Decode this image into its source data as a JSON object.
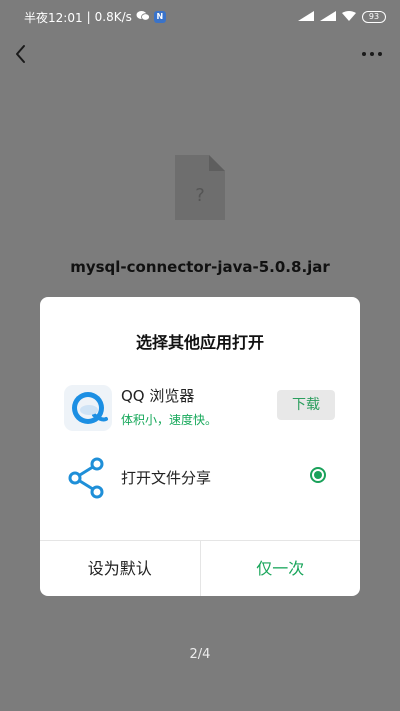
{
  "status_bar": {
    "time": "半夜12:01",
    "speed": "0.8K/s",
    "notification_badge": "N",
    "battery": "93"
  },
  "file": {
    "icon_glyph": "?",
    "name": "mysql-connector-java-5.0.8.jar"
  },
  "dialog": {
    "title": "选择其他应用打开",
    "apps": [
      {
        "name": "QQ 浏览器",
        "subtitle": "体积小，速度快。",
        "action": "下载",
        "icon": "qq-browser-icon"
      },
      {
        "name": "打开文件分享",
        "selected": true,
        "icon": "share-icon"
      }
    ],
    "footer": {
      "default_label": "设为默认",
      "once_label": "仅一次"
    }
  },
  "page_indicator": "2/4",
  "colors": {
    "overlay_bg": "#7c7c7c",
    "accent_green": "#19a55b",
    "share_icon_blue": "#1f8fd8"
  }
}
